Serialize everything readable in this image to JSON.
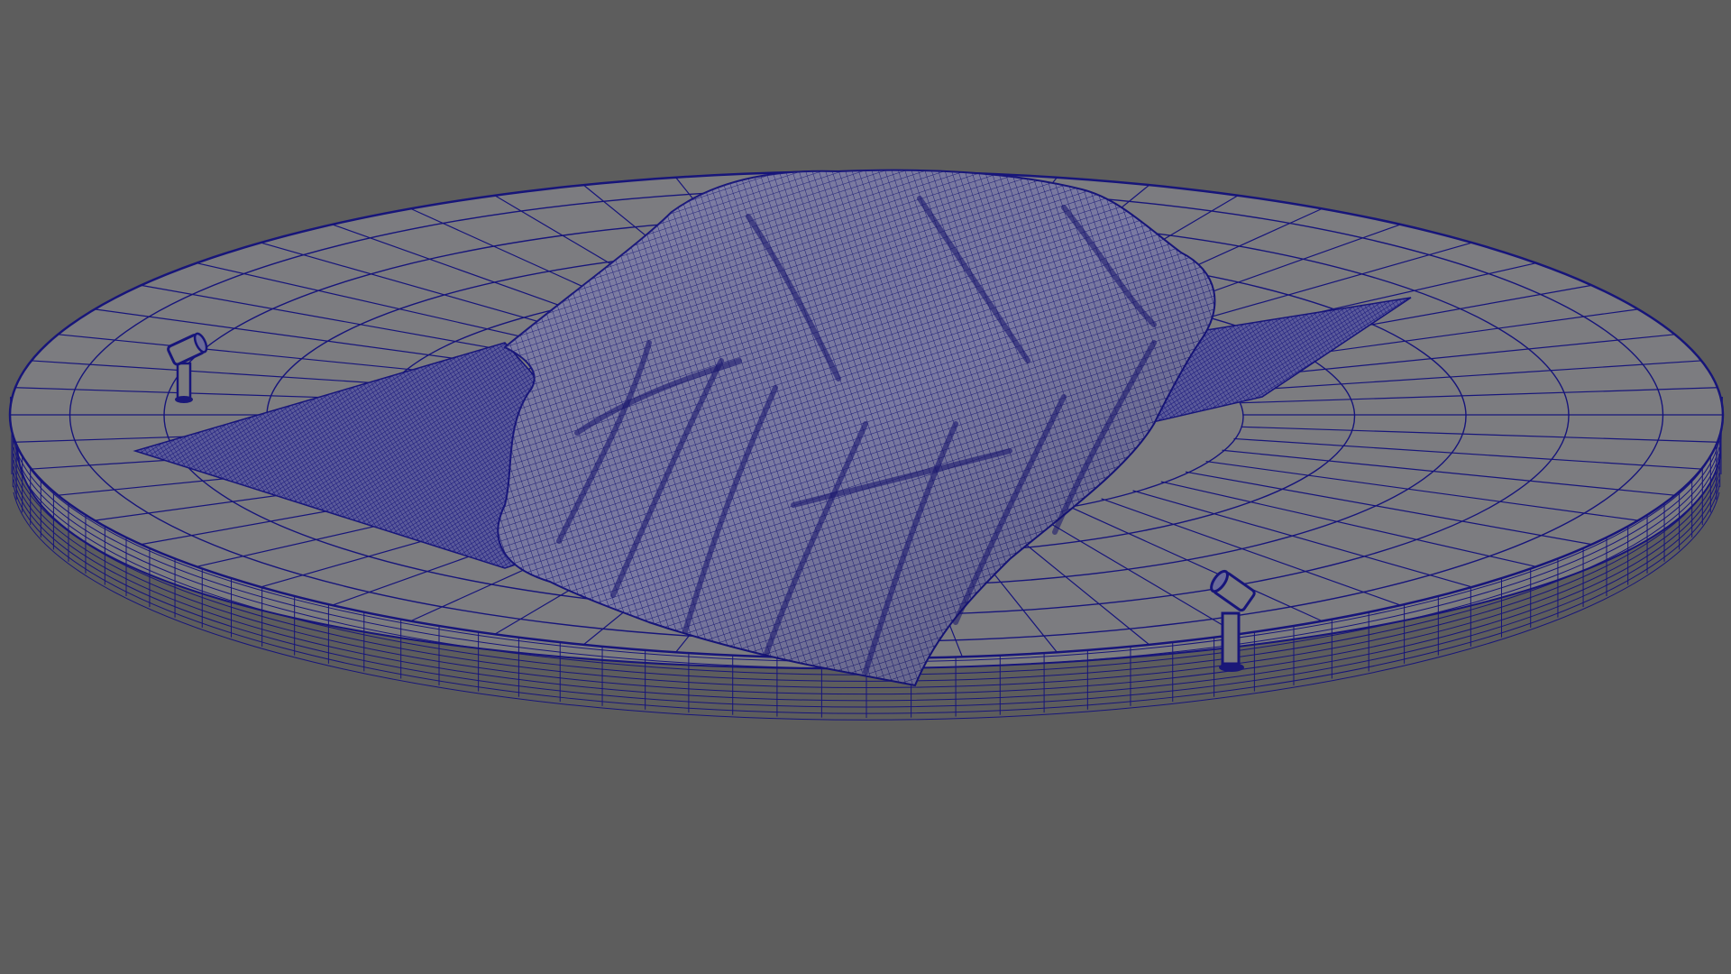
{
  "viewport": {
    "background_color": "#5d5d5d",
    "wire_color": "#17157a",
    "surface_color": "#7c7c80",
    "cloth_color": "#7a7aa2",
    "display_mode": "wireframe-on-shaded"
  },
  "scene": {
    "objects": [
      {
        "name": "turntable-platform",
        "icon": "cylinder-icon"
      },
      {
        "name": "car-cover-cloth",
        "icon": "cloth-icon"
      },
      {
        "name": "spotlight-left",
        "icon": "spotlight-icon"
      },
      {
        "name": "spotlight-right",
        "icon": "spotlight-icon"
      }
    ]
  }
}
